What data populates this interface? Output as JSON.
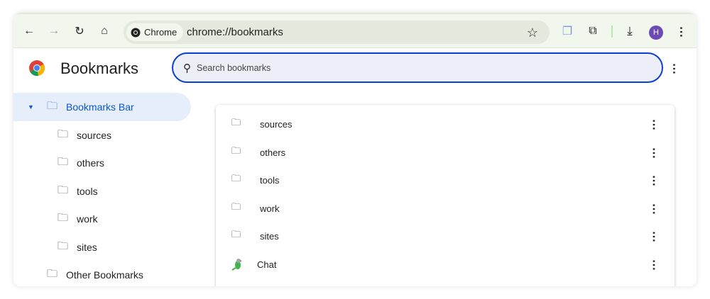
{
  "toolbar": {
    "chip_label": "Chrome",
    "url": "chrome://bookmarks",
    "avatar_initial": "H"
  },
  "page": {
    "title": "Bookmarks",
    "search_placeholder": "Search bookmarks"
  },
  "sidebar": {
    "root": "Bookmarks Bar",
    "children": [
      "sources",
      "others",
      "tools",
      "work",
      "sites"
    ],
    "other": "Other Bookmarks"
  },
  "list": {
    "folders": [
      "sources",
      "others",
      "tools",
      "work",
      "sites"
    ],
    "chat": "Chat"
  },
  "colors": {
    "accent": "#0b57d0",
    "toolbar": "#f2f7ed",
    "avatar": "#6c4bb6"
  }
}
